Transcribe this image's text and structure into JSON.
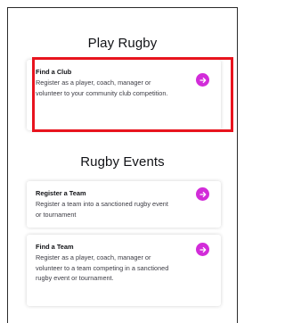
{
  "sections": {
    "play": {
      "title": "Play Rugby",
      "cards": [
        {
          "title": "Find a Club",
          "description": "Register as a player, coach, manager or volunteer to your community club competition.",
          "icon": "arrow-right-icon"
        }
      ]
    },
    "events": {
      "title": "Rugby Events",
      "cards": [
        {
          "title": "Register a Team",
          "description": "Register a team into a sanctioned rugby event or tournament",
          "icon": "arrow-right-icon"
        },
        {
          "title": "Find a Team",
          "description": "Register as a player, coach, manager or volunteer to a team competing in a sanctioned rugby event or tournament.",
          "icon": "arrow-right-icon"
        }
      ]
    }
  },
  "colors": {
    "accent": "#d22cd9",
    "highlight": "#e8141e",
    "text": "#111216"
  }
}
